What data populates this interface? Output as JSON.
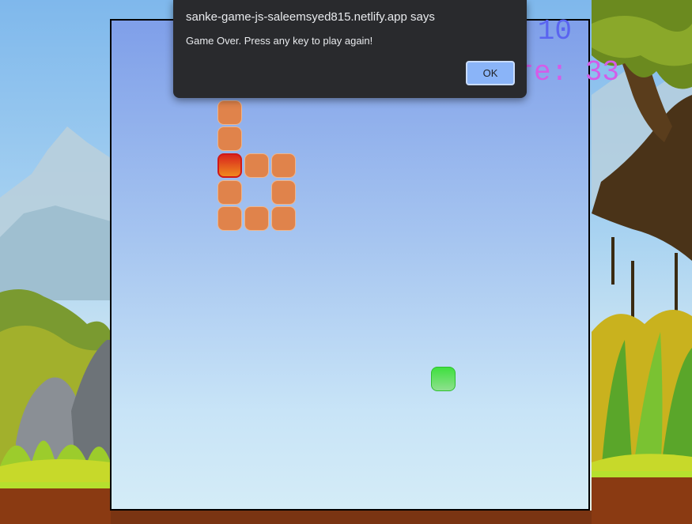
{
  "dialog": {
    "title": "sanke-game-js-saleemsyed815.netlify.app says",
    "message": "Game Over. Press any key to play again!",
    "ok_label": "OK"
  },
  "hud": {
    "hiscore_text": "10",
    "score_text": "re: 33"
  },
  "game": {
    "grid_size": 18,
    "snake_head": {
      "col": 5,
      "row": 6
    },
    "snake_body": [
      {
        "col": 5,
        "row": 4
      },
      {
        "col": 5,
        "row": 5
      },
      {
        "col": 6,
        "row": 6
      },
      {
        "col": 7,
        "row": 6
      },
      {
        "col": 5,
        "row": 7
      },
      {
        "col": 7,
        "row": 7
      },
      {
        "col": 5,
        "row": 8
      },
      {
        "col": 6,
        "row": 8
      },
      {
        "col": 7,
        "row": 8
      }
    ],
    "food": {
      "col": 13,
      "row": 14
    }
  },
  "colors": {
    "snake_body": "#e0834b",
    "snake_head": "#d8251d",
    "food": "#3fe03f",
    "hiscore": "#5a64f0",
    "score": "#d45ce8",
    "dialog_bg": "#292a2d",
    "ok_button": "#8ab4f8"
  }
}
